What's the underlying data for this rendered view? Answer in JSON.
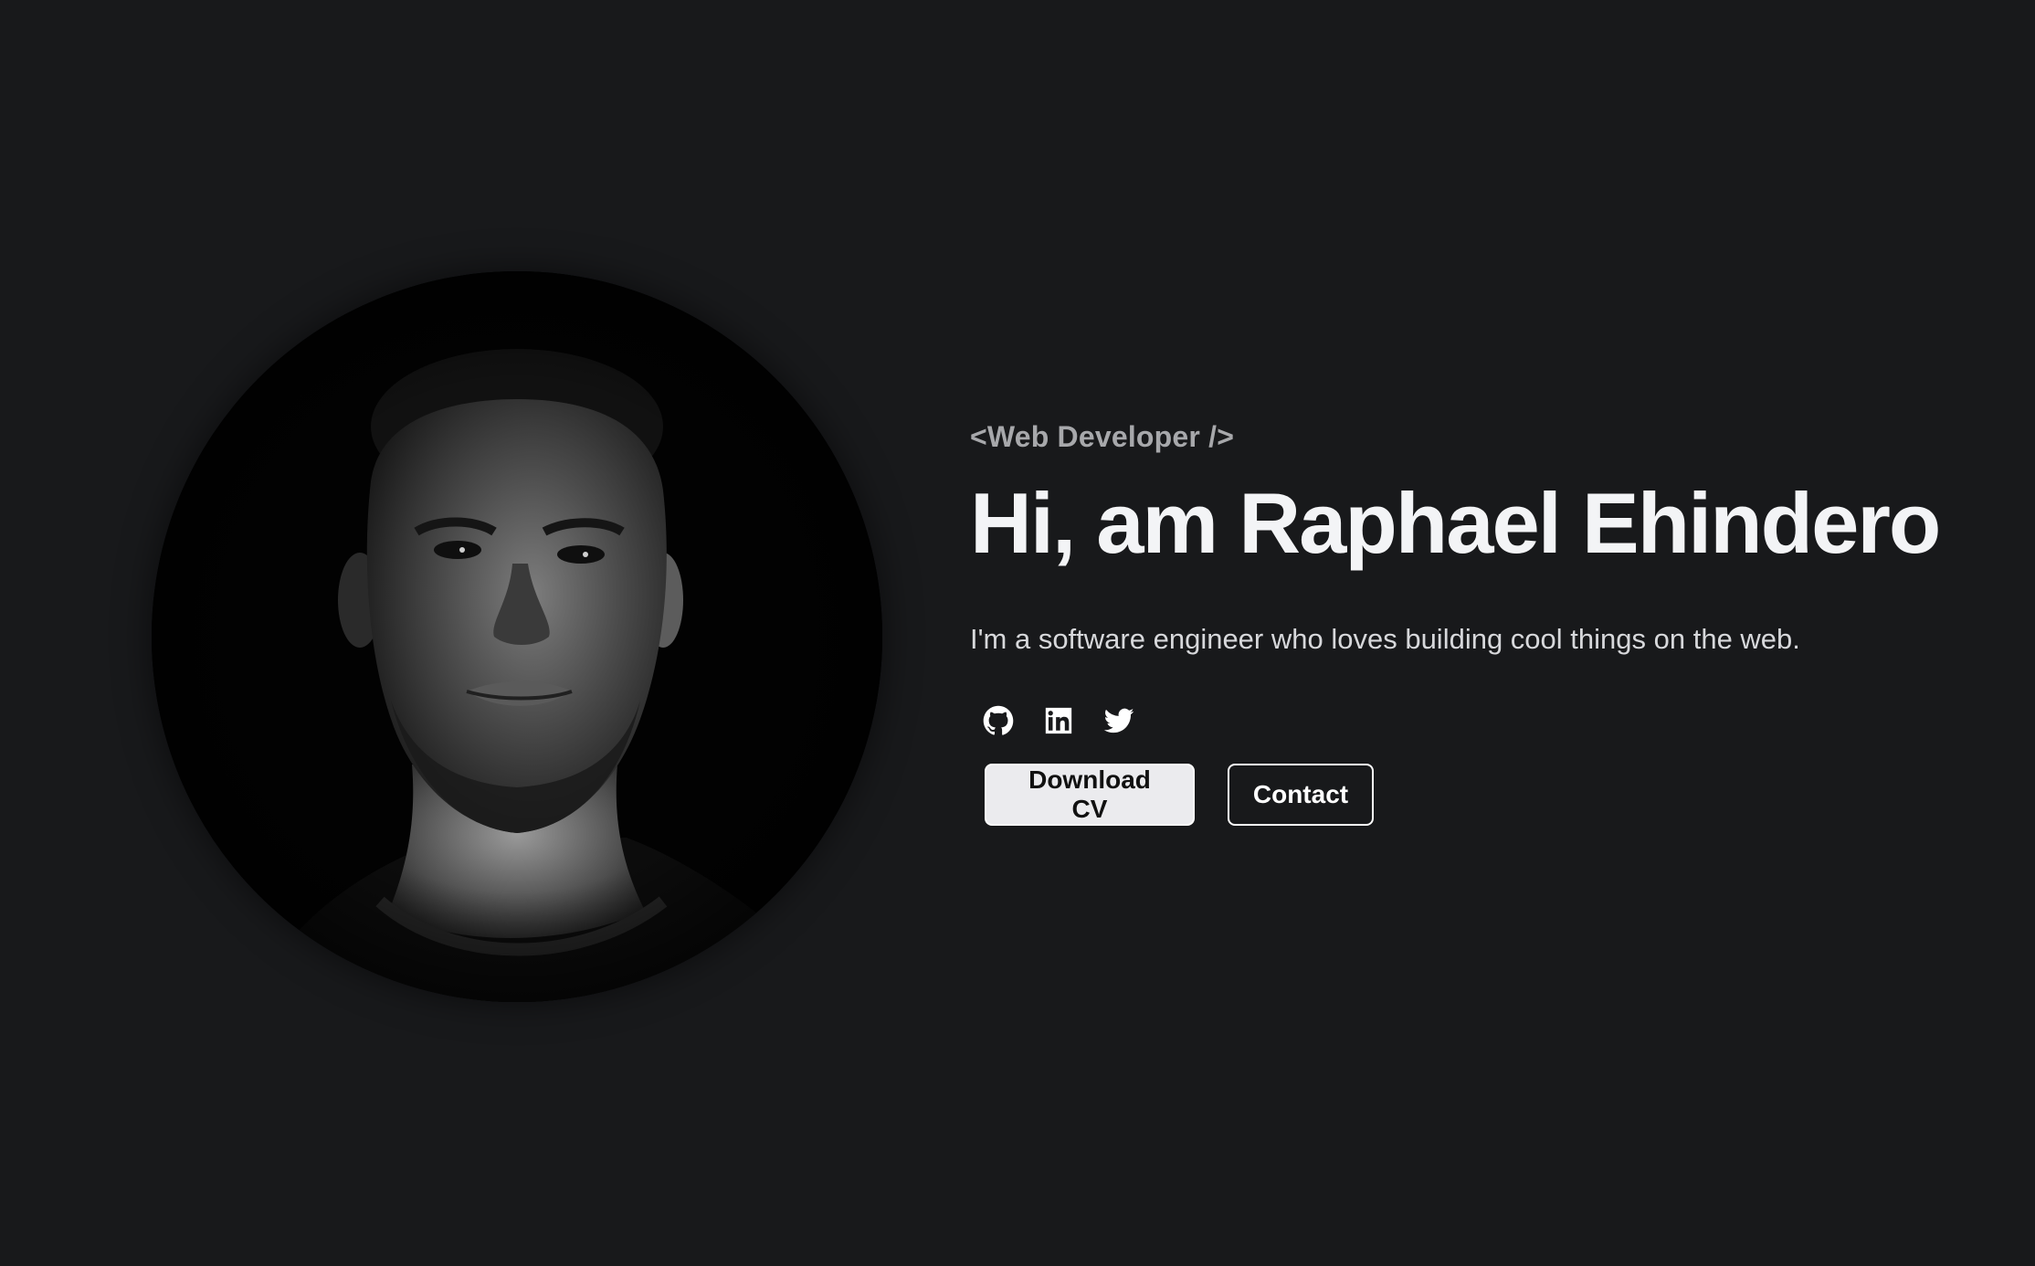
{
  "hero": {
    "role": "<Web Developer />",
    "headline": "Hi, am Raphael Ehindero",
    "tagline": "I'm a software engineer who loves building cool things on the web."
  },
  "socials": [
    {
      "icon": "github-icon"
    },
    {
      "icon": "linkedin-icon"
    },
    {
      "icon": "twitter-icon"
    }
  ],
  "actions": {
    "download_label": "Download CV",
    "contact_label": "Contact"
  },
  "colors": {
    "background": "#18191b",
    "heading": "#f3f4f6",
    "muted": "#a7a8ab",
    "primary_button_bg": "#ebebee"
  }
}
